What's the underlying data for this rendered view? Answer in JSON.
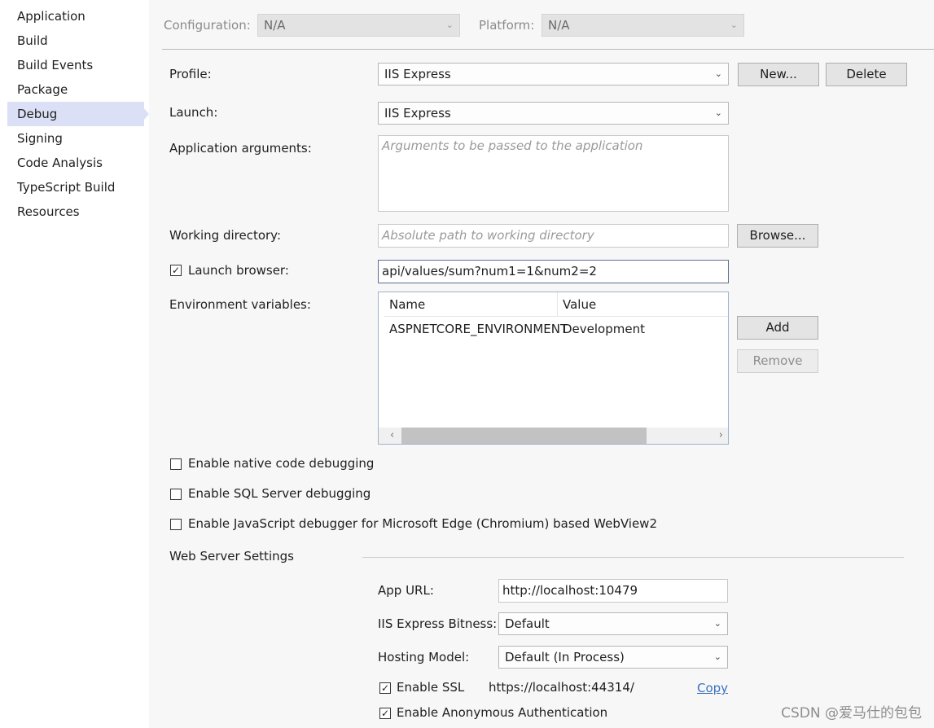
{
  "sidebar": {
    "items": [
      {
        "label": "Application"
      },
      {
        "label": "Build"
      },
      {
        "label": "Build Events"
      },
      {
        "label": "Package"
      },
      {
        "label": "Debug"
      },
      {
        "label": "Signing"
      },
      {
        "label": "Code Analysis"
      },
      {
        "label": "TypeScript Build"
      },
      {
        "label": "Resources"
      }
    ],
    "selected": "Debug"
  },
  "header": {
    "configuration_label": "Configuration:",
    "configuration_value": "N/A",
    "platform_label": "Platform:",
    "platform_value": "N/A"
  },
  "form": {
    "profile_label": "Profile:",
    "profile_value": "IIS Express",
    "new_button": "New...",
    "delete_button": "Delete",
    "launch_label": "Launch:",
    "launch_value": "IIS Express",
    "app_args_label": "Application arguments:",
    "app_args_placeholder": "Arguments to be passed to the application",
    "workdir_label": "Working directory:",
    "workdir_placeholder": "Absolute path to working directory",
    "browse_button": "Browse...",
    "launch_browser_label": "Launch browser:",
    "launch_browser_checked": true,
    "launch_browser_url": "api/values/sum?num1=1&num2=2",
    "env_label": "Environment variables:",
    "env_columns": [
      "Name",
      "Value"
    ],
    "env_rows": [
      {
        "name": "ASPNETCORE_ENVIRONMENT",
        "value": "Development"
      }
    ],
    "add_button": "Add",
    "remove_button": "Remove",
    "native_debug_label": "Enable native code debugging",
    "native_debug_checked": false,
    "sql_debug_label": "Enable SQL Server debugging",
    "sql_debug_checked": false,
    "js_debug_label": "Enable JavaScript debugger for Microsoft Edge (Chromium) based WebView2",
    "js_debug_checked": false
  },
  "web_server": {
    "section_label": "Web Server Settings",
    "app_url_label": "App URL:",
    "app_url_value": "http://localhost:10479",
    "bitness_label": "IIS Express Bitness:",
    "bitness_value": "Default",
    "hosting_label": "Hosting Model:",
    "hosting_value": "Default (In Process)",
    "ssl_label": "Enable SSL",
    "ssl_checked": true,
    "ssl_url": "https://localhost:44314/",
    "copy_link": "Copy",
    "anon_auth_label": "Enable Anonymous Authentication",
    "anon_auth_checked": true
  },
  "watermark": "CSDN @爱马仕的包包",
  "icons": {
    "dropdown": "chevron-down-icon",
    "check": "checkmark-icon",
    "scroll_left": "chevron-left-icon",
    "scroll_right": "chevron-right-icon"
  }
}
